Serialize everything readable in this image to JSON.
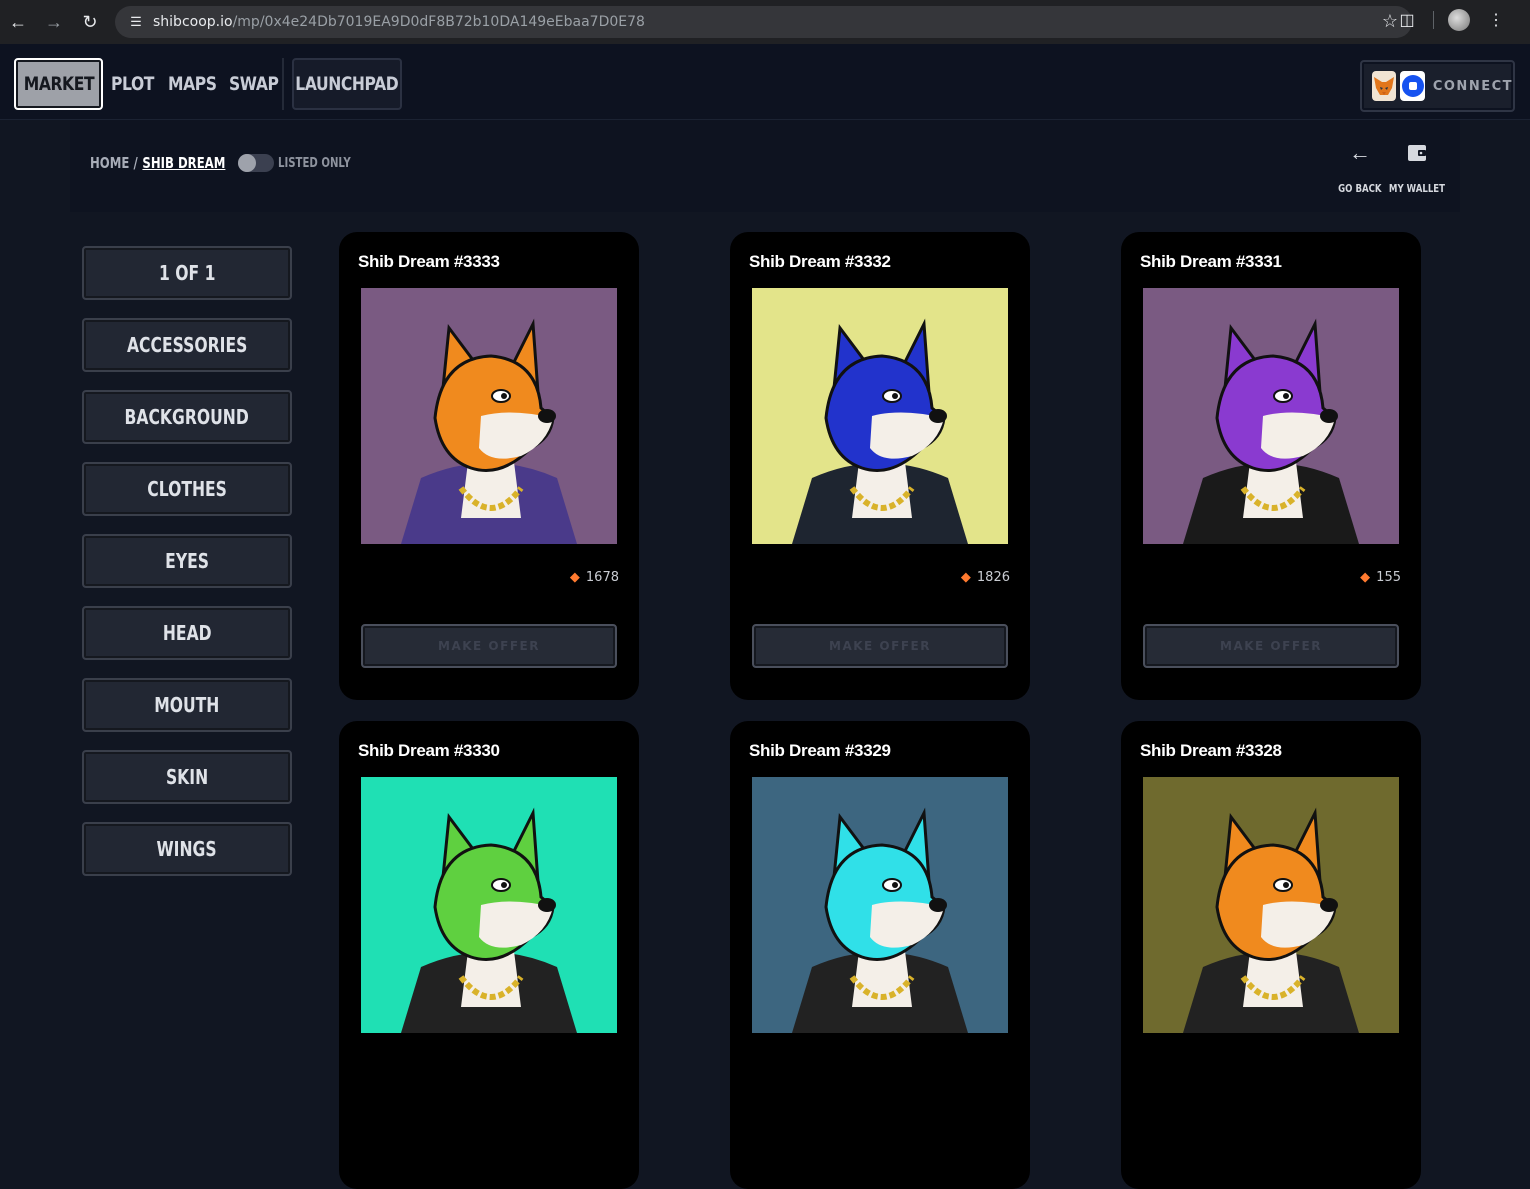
{
  "browser": {
    "url_host": "shibcoop.io",
    "url_path": "/mp/0x4e24Db7019EA9D0dF8B72b10DA149eEbaa7D0E78"
  },
  "topnav": {
    "items": [
      {
        "label": "MARKET"
      },
      {
        "label": "PLOT"
      },
      {
        "label": "MAPS"
      },
      {
        "label": "SWAP"
      },
      {
        "label": "LAUNCHPAD"
      }
    ],
    "connect_label": "CONNECT"
  },
  "breadcrumb": {
    "home": "HOME /",
    "current": "SHIB DREAM",
    "toggle_label": "LISTED ONLY"
  },
  "tools": {
    "back": "GO BACK",
    "wallet": "MY WALLET"
  },
  "filters": [
    "1 OF 1",
    "ACCESSORIES",
    "BACKGROUND",
    "CLOTHES",
    "EYES",
    "HEAD",
    "MOUTH",
    "SKIN",
    "WINGS"
  ],
  "cards": [
    {
      "title": "Shib Dream #3333",
      "rank": "1678",
      "offer": "MAKE OFFER",
      "bg": "#7a5a82",
      "fur": "#f08a1e",
      "accent": "#4a3a8a"
    },
    {
      "title": "Shib Dream #3332",
      "rank": "1826",
      "offer": "MAKE OFFER",
      "bg": "#e3e48a",
      "fur": "#2233cc",
      "accent": "#1e2530"
    },
    {
      "title": "Shib Dream #3331",
      "rank": "155",
      "offer": "MAKE OFFER",
      "bg": "#7a5a82",
      "fur": "#8a3ad0",
      "accent": "#1a1a1a"
    },
    {
      "title": "Shib Dream #3330",
      "bg": "#1fe0b4",
      "fur": "#5fd040"
    },
    {
      "title": "Shib Dream #3329",
      "bg": "#3d6680",
      "fur": "#30e0e8"
    },
    {
      "title": "Shib Dream #3328",
      "bg": "#6f6a2e",
      "fur": "#f08a1e"
    }
  ]
}
